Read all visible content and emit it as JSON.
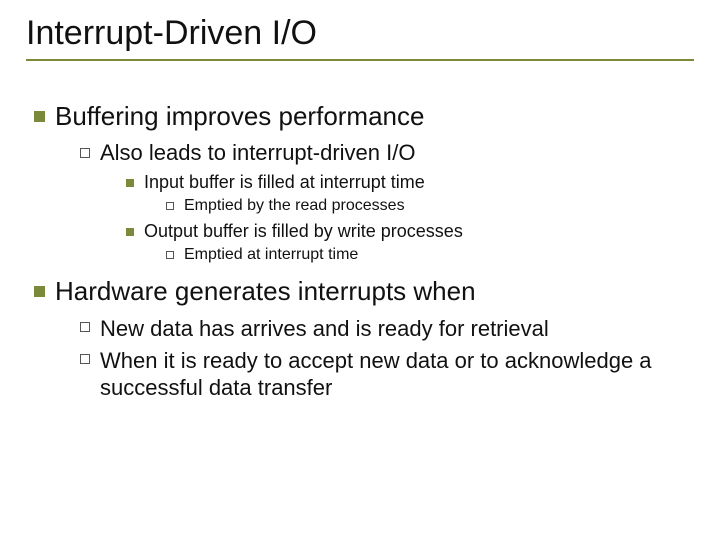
{
  "title": "Interrupt-Driven I/O",
  "outline": {
    "item1": {
      "text": "Buffering improves performance",
      "sub1": {
        "text": "Also leads to interrupt-driven I/O",
        "a": {
          "text": "Input buffer is filled at interrupt time",
          "i": "Emptied by the read processes"
        },
        "b": {
          "text": "Output buffer is filled by write processes",
          "i": "Emptied at interrupt time"
        }
      }
    },
    "item2": {
      "text": "Hardware generates interrupts when",
      "sub1": "New data has arrives and is ready for retrieval",
      "sub2": "When it is ready to accept new data or to acknowledge a successful data transfer"
    }
  }
}
